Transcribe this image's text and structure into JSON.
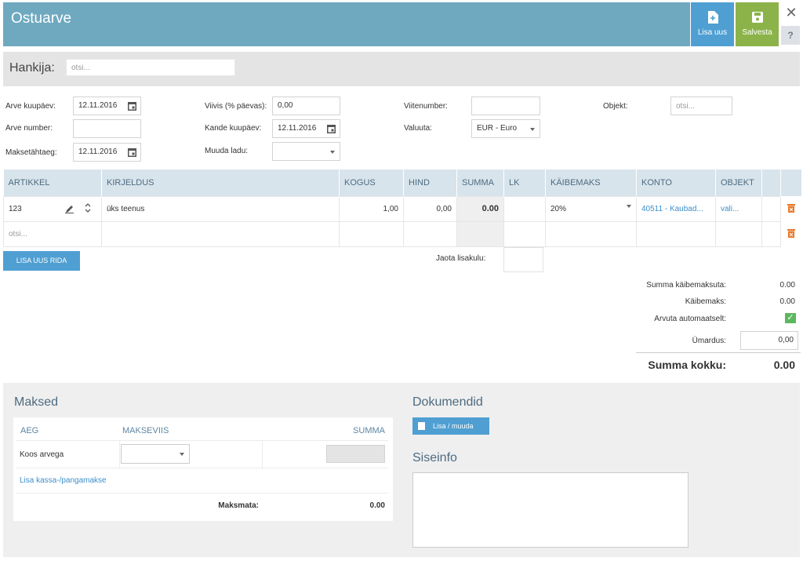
{
  "header": {
    "title": "Ostuarve",
    "add_label": "Lisa uus",
    "save_label": "Salvesta",
    "close_label": "✕",
    "help_label": "?"
  },
  "supplier": {
    "label": "Hankija:",
    "placeholder": "otsi..."
  },
  "form": {
    "invoice_date_label": "Arve kuupäev:",
    "invoice_date": "12.11.2016",
    "invoice_number_label": "Arve number:",
    "invoice_number": "",
    "due_date_label": "Maksetähtaeg:",
    "due_date": "12.11.2016",
    "penalty_label": "Viivis (% päevas):",
    "penalty": "0,00",
    "entry_date_label": "Kande kuupäev:",
    "entry_date": "12.11.2016",
    "warehouse_label": "Muuda ladu:",
    "warehouse": "",
    "reference_label": "Viitenumber:",
    "reference": "",
    "currency_label": "Valuuta:",
    "currency": "EUR - Euro",
    "object_label": "Objekt:",
    "object_placeholder": "otsi..."
  },
  "table": {
    "headers": [
      "ARTIKKEL",
      "KIRJELDUS",
      "KOGUS",
      "HIND",
      "SUMMA",
      "LK",
      "KÄIBEMAKS",
      "KONTO",
      "OBJEKT"
    ],
    "rows": [
      {
        "article": "123",
        "description": "üks teenus",
        "quantity": "1,00",
        "price": "0,00",
        "sum": "0.00",
        "lk": "",
        "vat": "20%",
        "account": "40511 - Kaubad...",
        "object": "vali..."
      }
    ],
    "search_placeholder": "otsi..."
  },
  "add_row_label": "LISA UUS RIDA",
  "distribute_label": "Jaota lisakulu:",
  "totals": {
    "net_label": "Summa käibemaksuta:",
    "net": "0.00",
    "vat_label": "Käibemaks:",
    "vat": "0.00",
    "auto_label": "Arvuta automaatselt:",
    "auto_checked": true,
    "rounding_label": "Ümardus:",
    "rounding": "0,00",
    "total_label": "Summa kokku:",
    "total": "0.00"
  },
  "payments": {
    "title": "Maksed",
    "col_time": "AEG",
    "col_method": "MAKSEVIIS",
    "col_sum": "SUMMA",
    "row_label": "Koos arvega",
    "add_link": "Lisa kassa-/pangamakse",
    "unpaid_label": "Maksmata:",
    "unpaid": "0.00"
  },
  "documents": {
    "title": "Dokumendid",
    "button": "Lisa / muuda"
  },
  "internal": {
    "title": "Siseinfo",
    "value": ""
  },
  "colors": {
    "header": "#6ea9c0",
    "add_button": "#4f9fd2",
    "save_button": "#8cb34a",
    "delete_icon": "#e8792c",
    "check": "#5cb85c"
  }
}
